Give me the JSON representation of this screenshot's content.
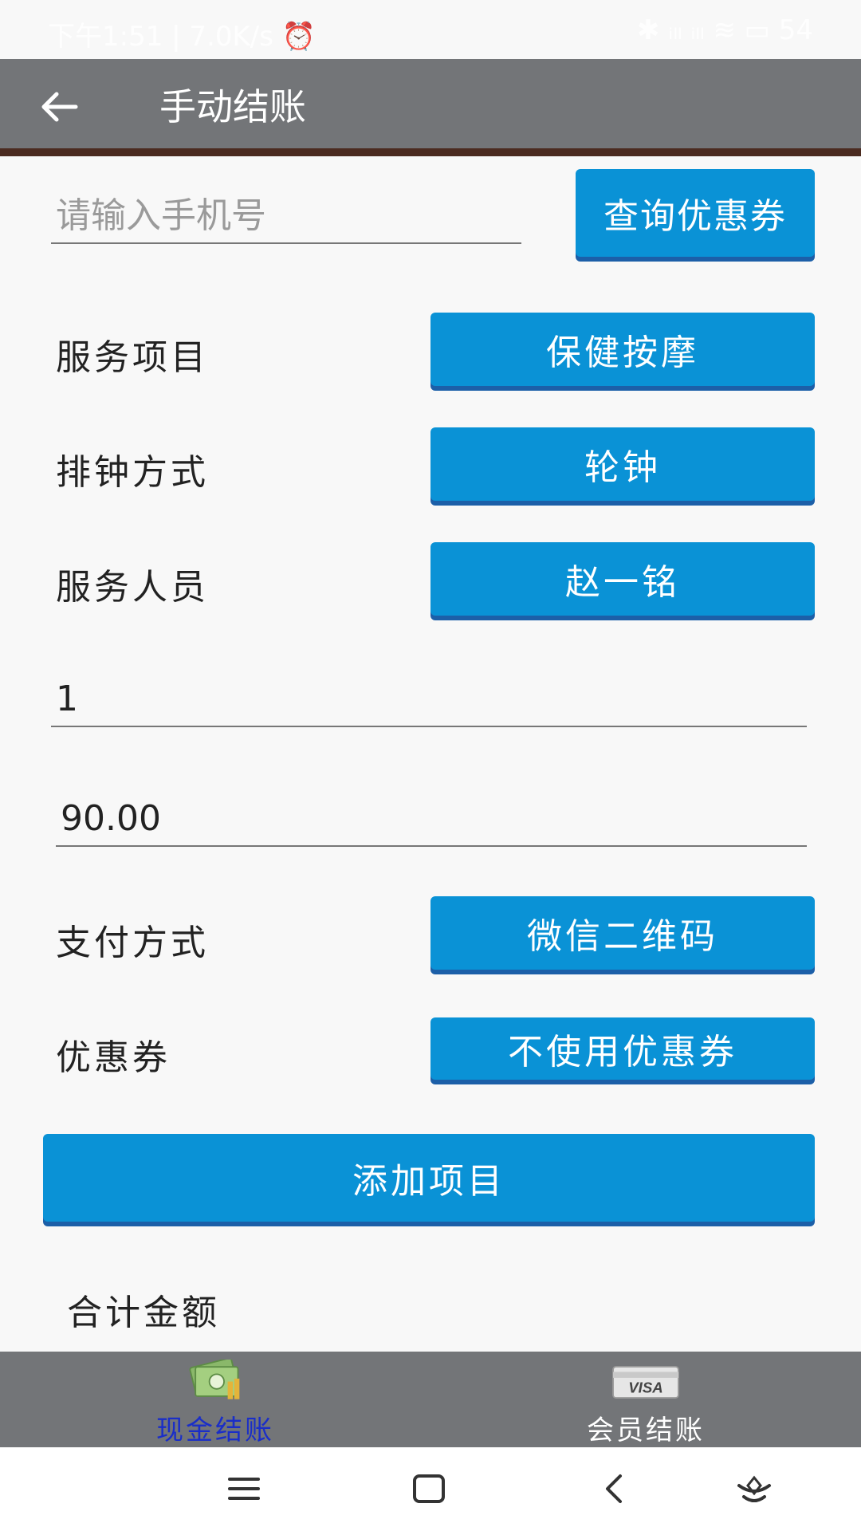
{
  "status_bar": {
    "left": "下午1:51 | 7.0K/s ⏰",
    "right": "✱ ᵢₗₗ ᵢₗₗ ≋ ▭ 54"
  },
  "toolbar": {
    "title": "手动结账"
  },
  "phone": {
    "placeholder": "请输入手机号",
    "query_button": "查询优惠券"
  },
  "service_item": {
    "label": "服务项目",
    "value": "保健按摩"
  },
  "schedule": {
    "label": "排钟方式",
    "value": "轮钟"
  },
  "staff": {
    "label": "服务人员",
    "value": "赵一铭"
  },
  "quantity": {
    "value": "1"
  },
  "price": {
    "value": "90.00"
  },
  "payment": {
    "label": "支付方式",
    "value": "微信二维码"
  },
  "coupon": {
    "label": "优惠券",
    "value": "不使用优惠券"
  },
  "add_button": "添加项目",
  "total": {
    "label": "合计金额"
  },
  "tabs": {
    "cash": {
      "label": "现金结账"
    },
    "member": {
      "label": "会员结账",
      "card_text": "VISA"
    }
  },
  "colors": {
    "accent": "#0a92d6",
    "toolbar": "#737578",
    "active_tab": "#1a2ec8"
  },
  "icons": [
    "back-arrow-icon",
    "cash-money-icon",
    "visa-card-icon",
    "menu-icon",
    "home-square-icon",
    "back-chevron-icon",
    "assistant-icon"
  ]
}
